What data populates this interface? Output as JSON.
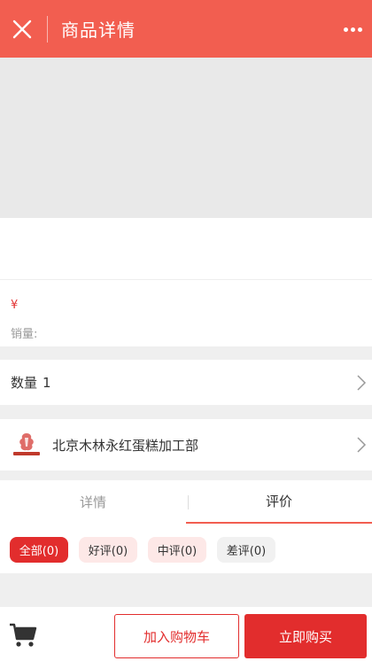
{
  "header": {
    "title": "商品详情",
    "close_icon": "close-icon",
    "more_icon": "more-horizontal-icon",
    "accent_color": "#f25e50"
  },
  "product": {
    "price_symbol": "¥",
    "sales_label": "销量:"
  },
  "quantity": {
    "label": "数量",
    "value": "1"
  },
  "shop": {
    "name": "北京木林永红蛋糕加工部"
  },
  "tabs": [
    {
      "label": "详情",
      "active": false
    },
    {
      "label": "评价",
      "active": true
    }
  ],
  "review_filters": [
    {
      "label": "全部(0)",
      "selected": true
    },
    {
      "label": "好评(0)",
      "selected": false
    },
    {
      "label": "中评(0)",
      "selected": false
    },
    {
      "label": "差评(0)",
      "selected": false
    }
  ],
  "bottom_bar": {
    "cart_icon": "cart-icon",
    "add_to_cart_label": "加入购物车",
    "buy_now_label": "立即购买",
    "button_color": "#e22d2d"
  }
}
